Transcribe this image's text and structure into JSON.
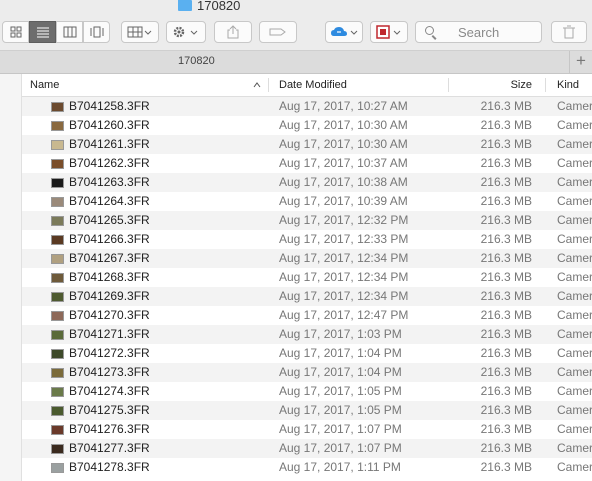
{
  "window": {
    "title": "170820"
  },
  "toolbar": {
    "search_placeholder": "Search"
  },
  "pathbar": {
    "label": "170820"
  },
  "columns": {
    "name": "Name",
    "date": "Date Modified",
    "size": "Size",
    "kind": "Kind"
  },
  "files": [
    {
      "name": "B7041258.3FR",
      "date": "Aug 17, 2017, 10:27 AM",
      "size": "216.3 MB",
      "kind": "Camer",
      "thumb": "#6b4a2e"
    },
    {
      "name": "B7041260.3FR",
      "date": "Aug 17, 2017, 10:30 AM",
      "size": "216.3 MB",
      "kind": "Camer",
      "thumb": "#8a6a40"
    },
    {
      "name": "B7041261.3FR",
      "date": "Aug 17, 2017, 10:30 AM",
      "size": "216.3 MB",
      "kind": "Camer",
      "thumb": "#c8b890"
    },
    {
      "name": "B7041262.3FR",
      "date": "Aug 17, 2017, 10:37 AM",
      "size": "216.3 MB",
      "kind": "Camer",
      "thumb": "#7a4e2a"
    },
    {
      "name": "B7041263.3FR",
      "date": "Aug 17, 2017, 10:38 AM",
      "size": "216.3 MB",
      "kind": "Camer",
      "thumb": "#1a1a1a"
    },
    {
      "name": "B7041264.3FR",
      "date": "Aug 17, 2017, 10:39 AM",
      "size": "216.3 MB",
      "kind": "Camer",
      "thumb": "#9a8a7a"
    },
    {
      "name": "B7041265.3FR",
      "date": "Aug 17, 2017, 12:32 PM",
      "size": "216.3 MB",
      "kind": "Camer",
      "thumb": "#7b7a5a"
    },
    {
      "name": "B7041266.3FR",
      "date": "Aug 17, 2017, 12:33 PM",
      "size": "216.3 MB",
      "kind": "Camer",
      "thumb": "#5a3a22"
    },
    {
      "name": "B7041267.3FR",
      "date": "Aug 17, 2017, 12:34 PM",
      "size": "216.3 MB",
      "kind": "Camer",
      "thumb": "#b0a080"
    },
    {
      "name": "B7041268.3FR",
      "date": "Aug 17, 2017, 12:34 PM",
      "size": "216.3 MB",
      "kind": "Camer",
      "thumb": "#6e5a3a"
    },
    {
      "name": "B7041269.3FR",
      "date": "Aug 17, 2017, 12:34 PM",
      "size": "216.3 MB",
      "kind": "Camer",
      "thumb": "#4e5a30"
    },
    {
      "name": "B7041270.3FR",
      "date": "Aug 17, 2017, 12:47 PM",
      "size": "216.3 MB",
      "kind": "Camer",
      "thumb": "#8e6a5a"
    },
    {
      "name": "B7041271.3FR",
      "date": "Aug 17, 2017, 1:03 PM",
      "size": "216.3 MB",
      "kind": "Camer",
      "thumb": "#5a6a3a"
    },
    {
      "name": "B7041272.3FR",
      "date": "Aug 17, 2017, 1:04 PM",
      "size": "216.3 MB",
      "kind": "Camer",
      "thumb": "#3e4a2a"
    },
    {
      "name": "B7041273.3FR",
      "date": "Aug 17, 2017, 1:04 PM",
      "size": "216.3 MB",
      "kind": "Camer",
      "thumb": "#7a6a3a"
    },
    {
      "name": "B7041274.3FR",
      "date": "Aug 17, 2017, 1:05 PM",
      "size": "216.3 MB",
      "kind": "Camer",
      "thumb": "#6a7a4a"
    },
    {
      "name": "B7041275.3FR",
      "date": "Aug 17, 2017, 1:05 PM",
      "size": "216.3 MB",
      "kind": "Camer",
      "thumb": "#4a5a2e"
    },
    {
      "name": "B7041276.3FR",
      "date": "Aug 17, 2017, 1:07 PM",
      "size": "216.3 MB",
      "kind": "Camer",
      "thumb": "#6a3a2a"
    },
    {
      "name": "B7041277.3FR",
      "date": "Aug 17, 2017, 1:07 PM",
      "size": "216.3 MB",
      "kind": "Camer",
      "thumb": "#3a2a1e"
    },
    {
      "name": "B7041278.3FR",
      "date": "Aug 17, 2017, 1:11 PM",
      "size": "216.3 MB",
      "kind": "Camer",
      "thumb": "#9aa0a0"
    }
  ],
  "icons": {
    "folder": "folder-icon",
    "icon_view": "grid-icon",
    "list_view": "list-icon",
    "column_view": "columns-icon",
    "coverflow_view": "coverflow-icon",
    "arrange": "arrange-icon",
    "action": "gear-icon",
    "share": "share-icon",
    "tags": "tag-icon",
    "icloud": "cloud-sync-icon",
    "app": "app-icon",
    "search": "search-icon",
    "trash": "trash-icon",
    "add_tab": "plus-icon"
  },
  "colors": {
    "accent_folder": "#5ab0f0",
    "cloud": "#2e8be0",
    "app_red": "#c0282e"
  }
}
